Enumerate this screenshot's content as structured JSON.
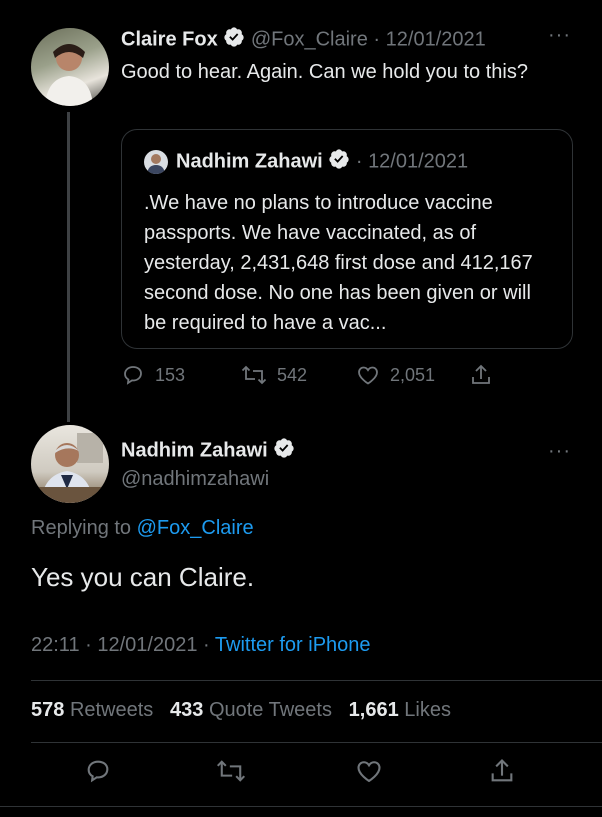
{
  "parent_tweet": {
    "author_name": "Claire Fox",
    "handle": "@Fox_Claire",
    "separator": "·",
    "date": "12/01/2021",
    "text": "Good to hear. Again. Can we hold you to this?",
    "more_label": "···",
    "quoted_tweet": {
      "author_name": "Nadhim Zahawi",
      "separator": "·",
      "date": "12/01/2021",
      "text": ".We have no plans to introduce vaccine passports. We have vaccinated, as of yesterday, 2,431,648 first dose and 412,167 second dose. No one has been given or will be required to have a vac..."
    },
    "actions": {
      "replies": "153",
      "retweets": "542",
      "likes": "2,051"
    }
  },
  "main_tweet": {
    "author_name": "Nadhim Zahawi",
    "handle": "@nadhimzahawi",
    "more_label": "···",
    "replying_prefix": "Replying to",
    "replying_handle": "@Fox_Claire",
    "text": "Yes you can Claire.",
    "time": "22:11",
    "separator": "·",
    "date": "12/01/2021",
    "separator2": "·",
    "source": "Twitter for iPhone",
    "stats": {
      "retweets_count": "578",
      "retweets_label": "Retweets",
      "quotes_count": "433",
      "quotes_label": "Quote Tweets",
      "likes_count": "1,661",
      "likes_label": "Likes"
    }
  },
  "colors": {
    "background": "#000000",
    "text": "#e7e9ea",
    "muted": "#71767b",
    "accent": "#1d9bf0",
    "divider": "#2f3336"
  }
}
